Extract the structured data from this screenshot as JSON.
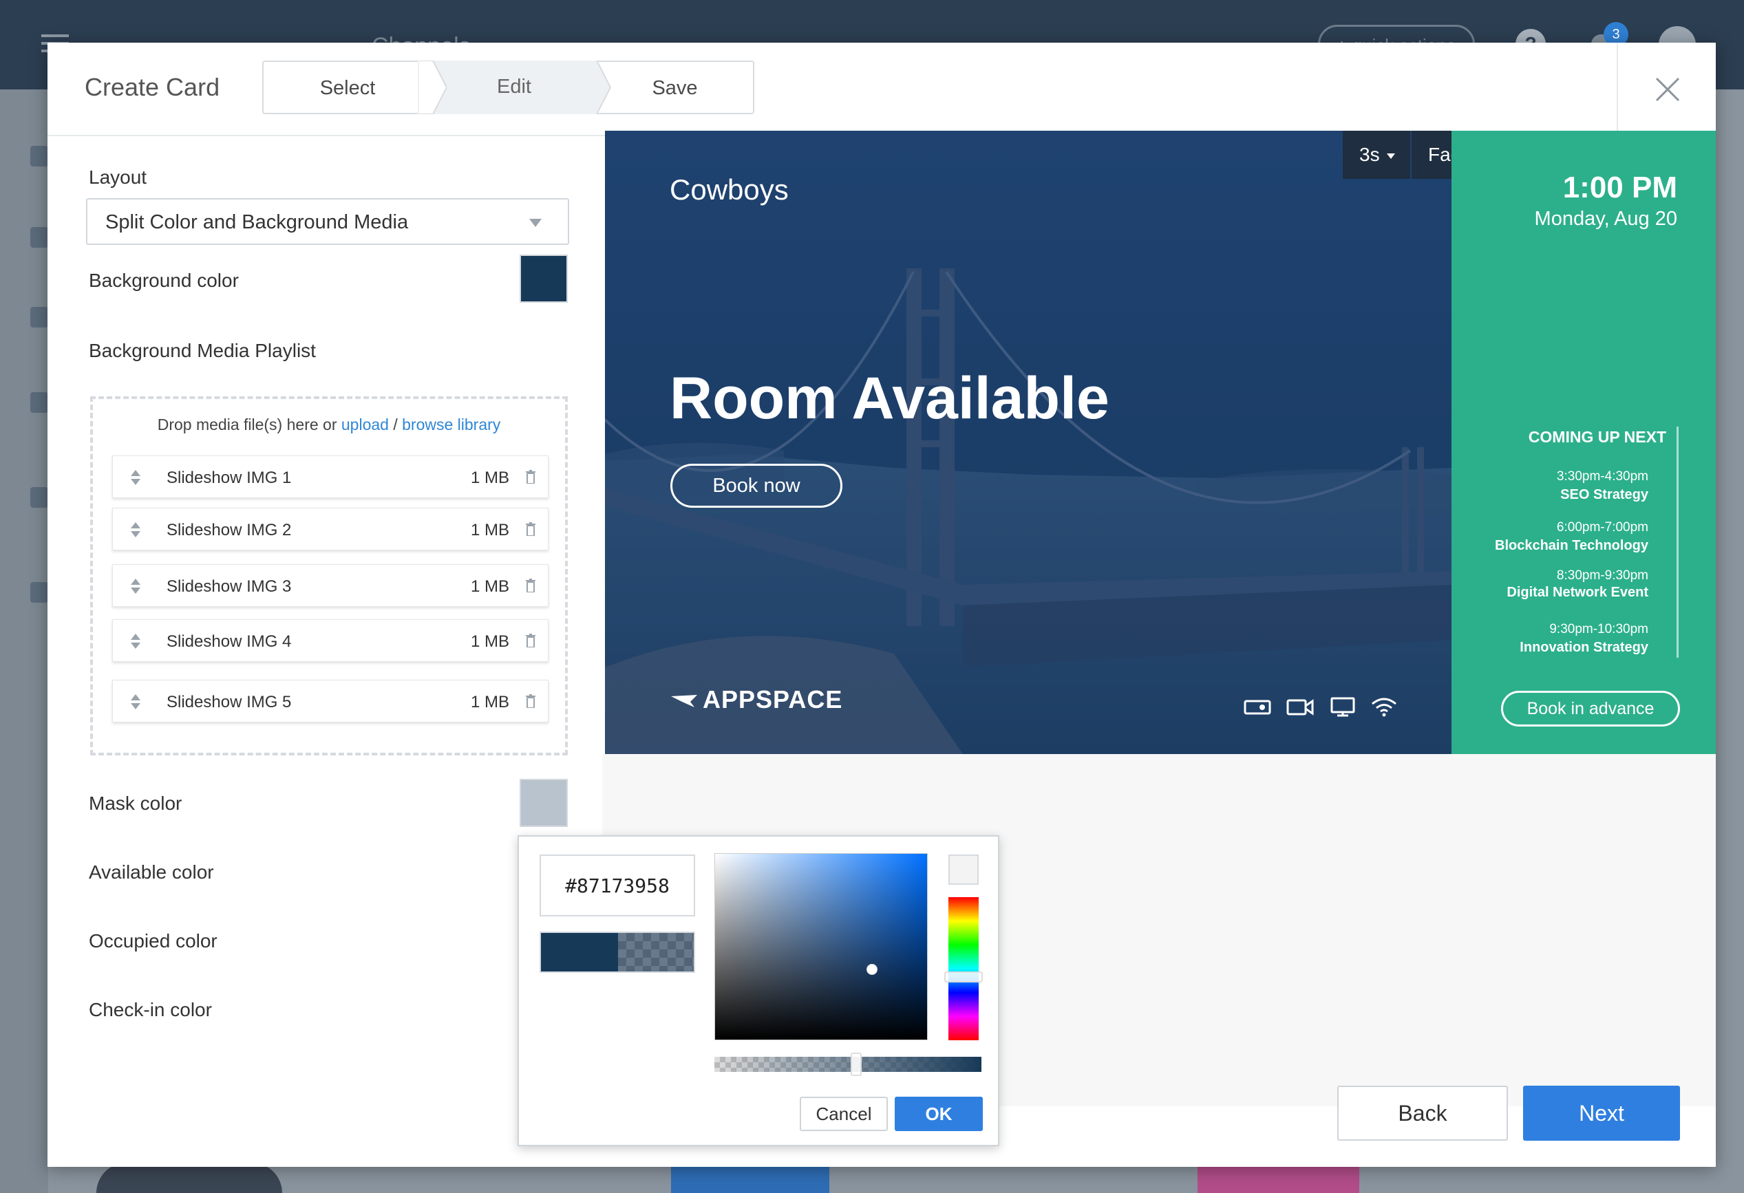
{
  "background_app": {
    "title": "Channels",
    "quick_actions_label": "+ quick actions",
    "help_label": "?",
    "notification_count": "3"
  },
  "modal": {
    "title": "Create Card",
    "steps": [
      "Select",
      "Edit",
      "Save"
    ],
    "active_step": "Edit",
    "close_icon": "close-icon"
  },
  "form": {
    "layout_label": "Layout",
    "layout_value": "Split Color and Background Media",
    "background_color_label": "Background color",
    "background_color_value": "#173958",
    "media_playlist_label": "Background Media Playlist",
    "drop_text": "Drop media file(s) here or",
    "upload_link": "upload",
    "separator": "/",
    "browse_link": "browse library",
    "media_items": [
      {
        "name": "Slideshow IMG 1",
        "size": "1 MB"
      },
      {
        "name": "Slideshow IMG 2",
        "size": "1 MB"
      },
      {
        "name": "Slideshow IMG 3",
        "size": "1 MB"
      },
      {
        "name": "Slideshow IMG 4",
        "size": "1 MB"
      },
      {
        "name": "Slideshow IMG 5",
        "size": "1 MB"
      }
    ],
    "mask_color_label": "Mask color",
    "mask_color_value": "#b9c3cd",
    "available_color_label": "Available color",
    "occupied_color_label": "Occupied color",
    "checkin_color_label": "Check-in color"
  },
  "preview": {
    "duration": "3s",
    "transition": "Fade",
    "room_name": "Cowboys",
    "status": "Room Available",
    "book_now": "Book now",
    "logo_text": "APPSPACE",
    "time": "1:00 PM",
    "date": "Monday, Aug 20",
    "coming_up_title": "COMING UP NEXT",
    "events": [
      {
        "time": "3:30pm-4:30pm",
        "name": "SEO Strategy"
      },
      {
        "time": "6:00pm-7:00pm",
        "name": "Blockchain Technology"
      },
      {
        "time": "8:30pm-9:30pm",
        "name": "Digital Network Event"
      },
      {
        "time": "9:30pm-10:30pm",
        "name": "Innovation Strategy"
      }
    ],
    "book_in_advance": "Book in advance",
    "amenity_icons": [
      "projector-icon",
      "video-camera-icon",
      "monitor-icon",
      "wifi-icon"
    ],
    "side_color": "#2cb08b"
  },
  "color_picker": {
    "hex_value": "#87173958",
    "cancel_label": "Cancel",
    "ok_label": "OK"
  },
  "footer": {
    "back_label": "Back",
    "next_label": "Next"
  }
}
